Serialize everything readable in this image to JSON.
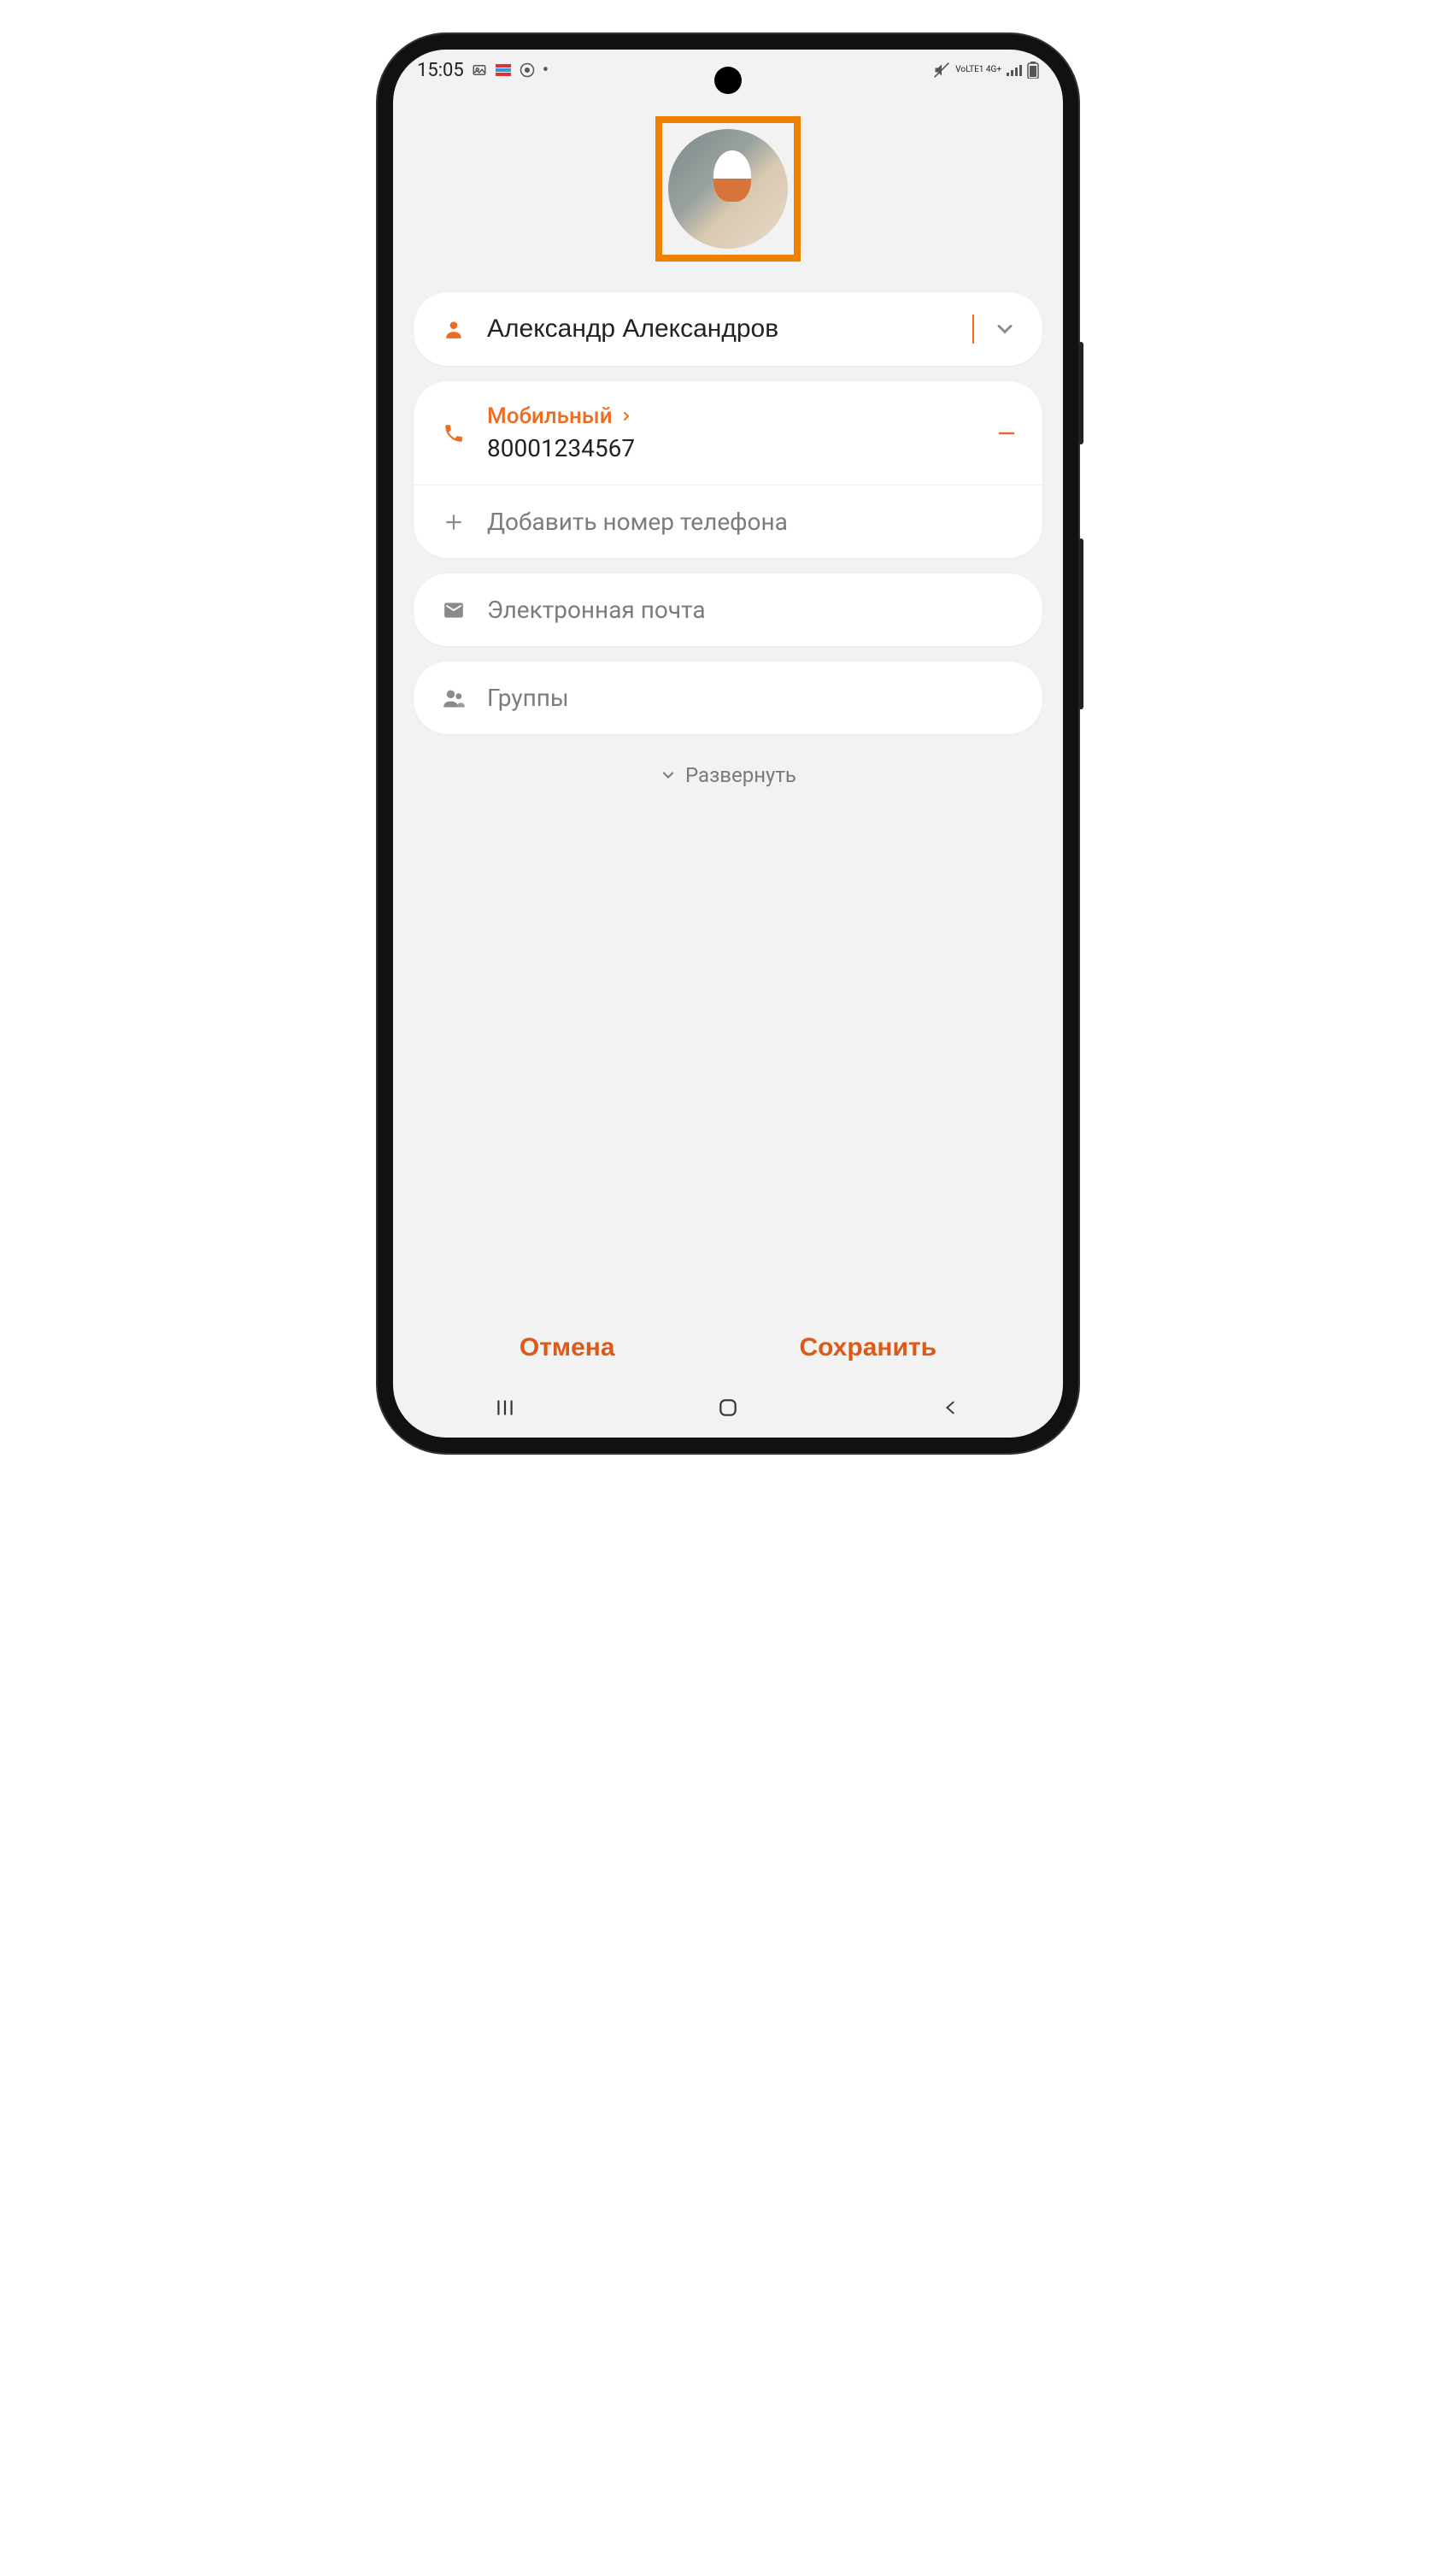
{
  "status": {
    "time": "15:05",
    "network_label": "VoLTE1 4G+"
  },
  "avatar": {
    "highlight_color": "#f08000"
  },
  "name_field": {
    "value": "Александр Александров"
  },
  "phone": {
    "type_label": "Мобильный",
    "number": "80001234567",
    "add_label": "Добавить номер телефона"
  },
  "email": {
    "placeholder": "Электронная почта"
  },
  "groups": {
    "label": "Группы"
  },
  "expand": {
    "label": "Развернуть"
  },
  "actions": {
    "cancel": "Отмена",
    "save": "Сохранить"
  }
}
